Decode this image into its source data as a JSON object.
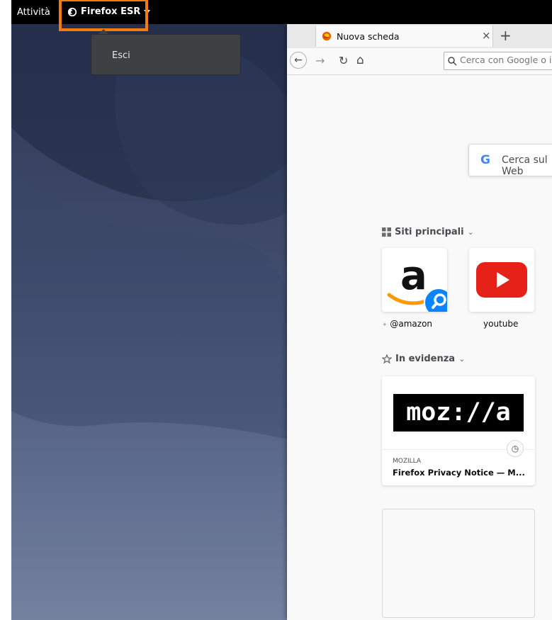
{
  "topbar": {
    "activities_label": "Attività",
    "app_menu_label": "Firefox ESR",
    "app_menu_arrow_icon": "triangle-down-icon"
  },
  "popup_menu": {
    "items": [
      {
        "label": "Esci"
      }
    ]
  },
  "browser": {
    "tab": {
      "title": "Nuova scheda",
      "close_icon": "×"
    },
    "new_tab_icon": "+",
    "nav": {
      "back": "←",
      "forward": "→",
      "reload": "↻",
      "home": "⌂"
    },
    "url_bar": {
      "placeholder": "Cerca con Google o inserisci un indirizzo",
      "search_icon": "search-icon"
    },
    "search_box": {
      "g_logo": "G",
      "placeholder": "Cerca sul Web"
    },
    "top_sites": {
      "title": "Siti principali",
      "tiles": [
        {
          "label": "@amazon",
          "icon": "amazon-logo-with-search-badge"
        },
        {
          "label": "youtube",
          "icon": "youtube-logo"
        }
      ]
    },
    "highlights": {
      "title": "In evidenza",
      "cards": [
        {
          "logo_text": "moz://a",
          "source": "MOZILLA",
          "title": "Firefox Privacy Notice — M..."
        }
      ]
    }
  },
  "colors": {
    "highlight_outline": "#f57b10",
    "topbar_bg": "#000000",
    "youtube_red": "#e62117",
    "amazon_orange": "#ff9900"
  }
}
